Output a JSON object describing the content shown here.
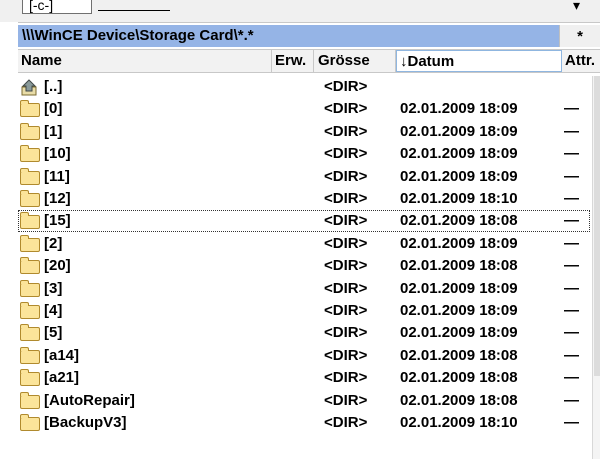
{
  "window": {
    "top_arrow": "▾",
    "drive_label": "[-c-]"
  },
  "path_bar": {
    "path": "\\\\\\WinCE Device\\Storage Card\\*.*",
    "star_button": "*"
  },
  "columns": {
    "name": "Name",
    "ext": "Erw.",
    "size": "Grösse",
    "date": "↓Datum",
    "attr": "Attr."
  },
  "rows": [
    {
      "icon": "up-arrow-icon",
      "name": "[..]",
      "size": "<DIR>",
      "date": "",
      "attr": ""
    },
    {
      "icon": "folder-icon",
      "name": "[0]",
      "size": "<DIR>",
      "date": "02.01.2009 18:09",
      "attr": "—"
    },
    {
      "icon": "folder-icon",
      "name": "[1]",
      "size": "<DIR>",
      "date": "02.01.2009 18:09",
      "attr": "—"
    },
    {
      "icon": "folder-icon",
      "name": "[10]",
      "size": "<DIR>",
      "date": "02.01.2009 18:09",
      "attr": "—"
    },
    {
      "icon": "folder-icon",
      "name": "[11]",
      "size": "<DIR>",
      "date": "02.01.2009 18:09",
      "attr": "—"
    },
    {
      "icon": "folder-icon",
      "name": "[12]",
      "size": "<DIR>",
      "date": "02.01.2009 18:10",
      "attr": "—"
    },
    {
      "icon": "folder-icon",
      "name": "[15]",
      "size": "<DIR>",
      "date": "02.01.2009 18:08",
      "attr": "—",
      "focused": true
    },
    {
      "icon": "folder-icon",
      "name": "[2]",
      "size": "<DIR>",
      "date": "02.01.2009 18:09",
      "attr": "—"
    },
    {
      "icon": "folder-icon",
      "name": "[20]",
      "size": "<DIR>",
      "date": "02.01.2009 18:08",
      "attr": "—"
    },
    {
      "icon": "folder-icon",
      "name": "[3]",
      "size": "<DIR>",
      "date": "02.01.2009 18:09",
      "attr": "—"
    },
    {
      "icon": "folder-icon",
      "name": "[4]",
      "size": "<DIR>",
      "date": "02.01.2009 18:09",
      "attr": "—"
    },
    {
      "icon": "folder-icon",
      "name": "[5]",
      "size": "<DIR>",
      "date": "02.01.2009 18:09",
      "attr": "—"
    },
    {
      "icon": "folder-icon",
      "name": "[a14]",
      "size": "<DIR>",
      "date": "02.01.2009 18:08",
      "attr": "—"
    },
    {
      "icon": "folder-icon",
      "name": "[a21]",
      "size": "<DIR>",
      "date": "02.01.2009 18:08",
      "attr": "—"
    },
    {
      "icon": "folder-icon",
      "name": "[AutoRepair]",
      "size": "<DIR>",
      "date": "02.01.2009 18:08",
      "attr": "—"
    },
    {
      "icon": "folder-icon",
      "name": "[BackupV3]",
      "size": "<DIR>",
      "date": "02.01.2009 18:10",
      "attr": "—"
    }
  ],
  "colors": {
    "path_bar": "#95b4e6",
    "folder_fill": "#fbe49a",
    "folder_stroke": "#b08a2e"
  }
}
